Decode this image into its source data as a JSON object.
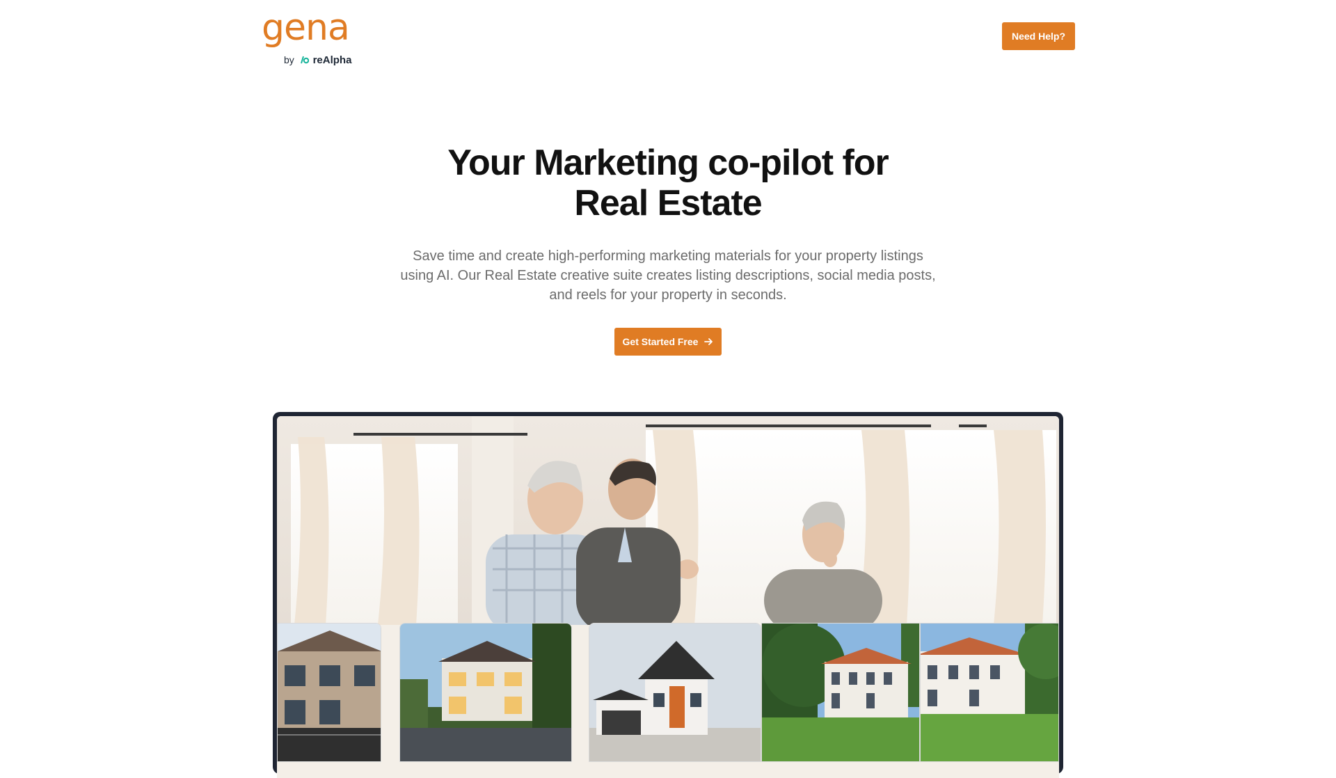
{
  "header": {
    "logo": {
      "wordmark": "gena",
      "by_text": "by",
      "brand_name": "reAlpha"
    },
    "help_button_label": "Need Help?"
  },
  "hero": {
    "title_line1": "Your Marketing co-pilot for",
    "title_line2": "Real Estate",
    "subtitle": "Save time and create high-performing marketing materials for your property listings using AI. Our Real Estate creative suite creates listing descriptions, social media posts, and reels for your property in seconds.",
    "cta_label": "Get Started Free",
    "cta_icon": "arrow-right-icon"
  },
  "showcase": {
    "hero_image": "agents-showing-home-image",
    "cards": [
      {
        "image": "two-story-townhouse-image"
      },
      {
        "image": "modern-villa-evening-image"
      },
      {
        "image": "white-house-orange-accent-image"
      },
      {
        "image": "white-mansion-garden-image"
      }
    ]
  },
  "colors": {
    "accent": "#e07c24",
    "frame": "#1f2533",
    "title": "#111111",
    "subtitle": "#6b6b6b"
  }
}
